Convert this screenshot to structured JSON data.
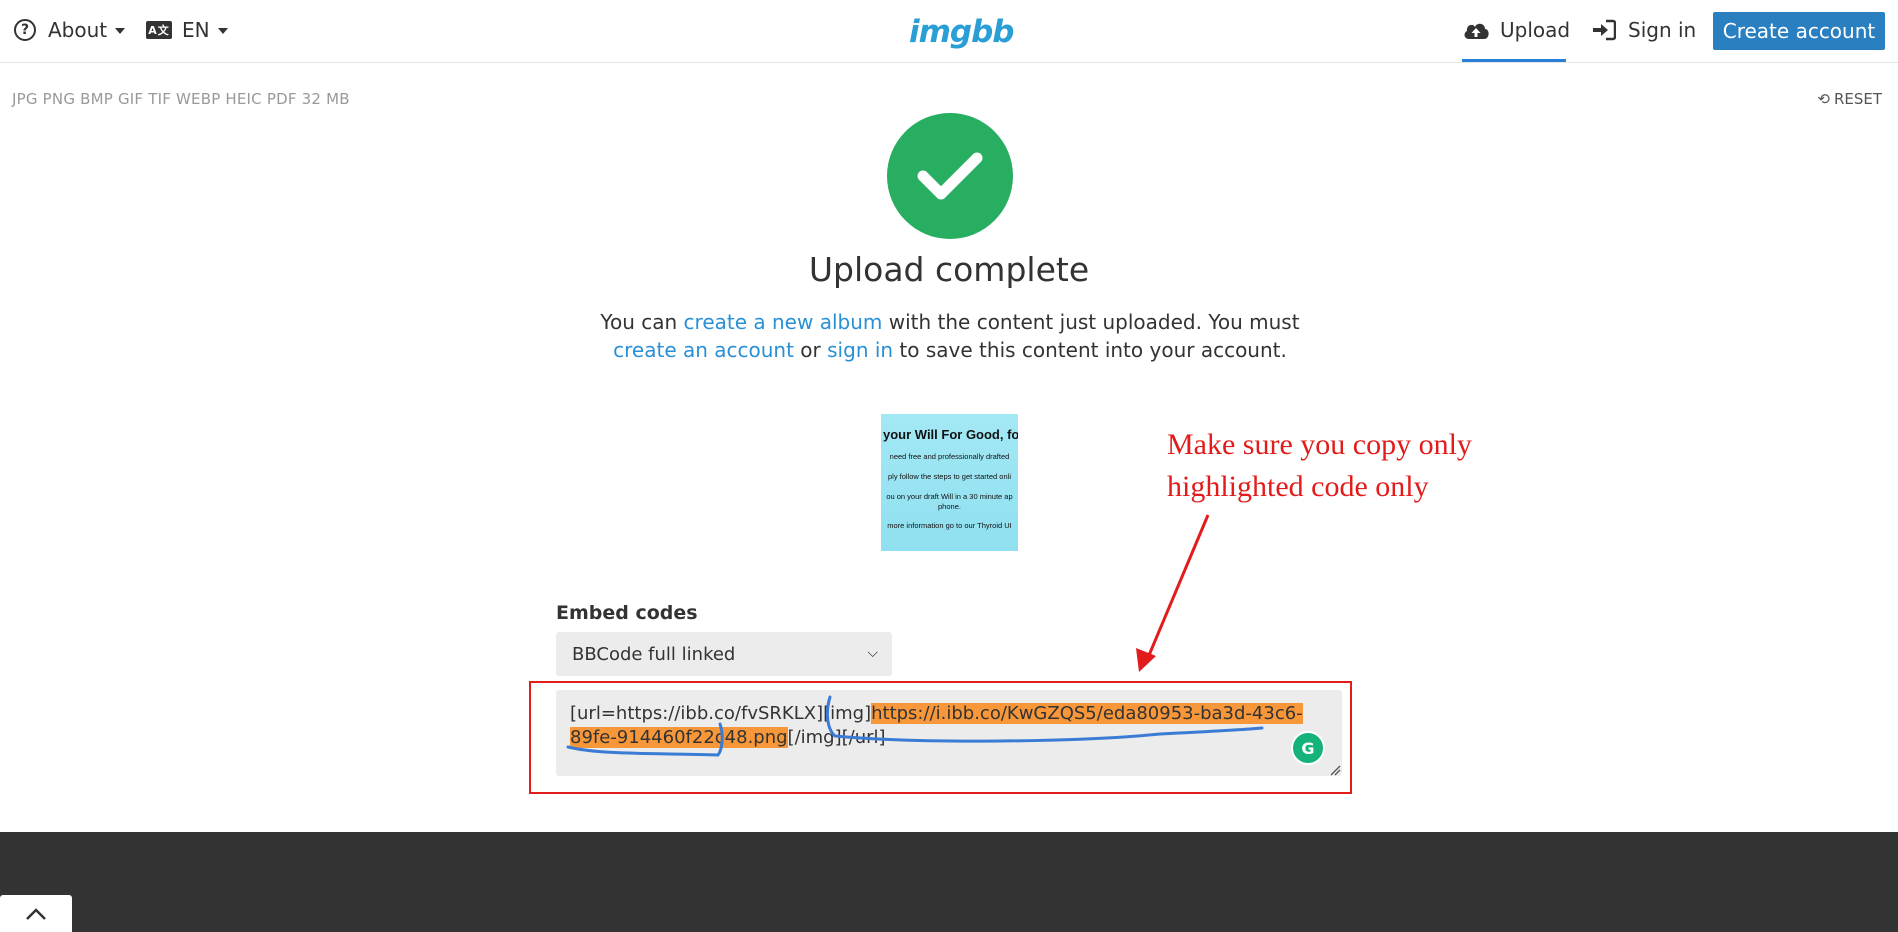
{
  "header": {
    "about_label": "About",
    "lang_label": "EN",
    "logo": "imgbb",
    "upload_label": "Upload",
    "signin_label": "Sign in",
    "create_account_label": "Create account"
  },
  "toolbar": {
    "formats": "JPG PNG BMP GIF TIF WEBP HEIC PDF   32 MB",
    "reset_label": "RESET"
  },
  "main": {
    "title": "Upload complete",
    "desc_1": "You can ",
    "desc_link_album": "create a new album",
    "desc_2": " with the content just uploaded. You must ",
    "desc_link_account": "create an account",
    "desc_3": " or ",
    "desc_link_signin": "sign in",
    "desc_4": " to save this content into your account."
  },
  "thumbnail": {
    "line1": "your Will For Good, fo",
    "line2": "need free and professionally drafted",
    "line3": "ply follow the steps to get started onli",
    "line4": "ou on your draft Will in a 30 minute ap",
    "line5": "phone.",
    "line6": "more information go to our Thyroid UI"
  },
  "annotation": {
    "line1": "Make sure you copy only",
    "line2": "highlighted code only"
  },
  "embed": {
    "label": "Embed codes",
    "selected": "BBCode full linked",
    "code_before": "[url=https://ibb.co/fvSRKLX][img]",
    "code_highlight": "https://i.ibb.co/KwGZQS5/eda80953-ba3d-43c6-89fe-914460f22c48.png",
    "code_after": "[/img][/url]"
  },
  "colors": {
    "accent": "#2a7fc1",
    "success": "#27ae60",
    "annotation_red": "#e21b1b",
    "highlight": "#f7973a",
    "scribble_blue": "#3a7bd5",
    "footer": "#333333"
  },
  "icons": {
    "about": "help-circle-icon",
    "lang": "language-icon",
    "upload": "cloud-upload-icon",
    "signin": "sign-in-icon",
    "reset": "undo-icon",
    "success": "check-icon",
    "grammarly": "grammarly-icon",
    "footer_toggle": "chevron-up-icon"
  }
}
